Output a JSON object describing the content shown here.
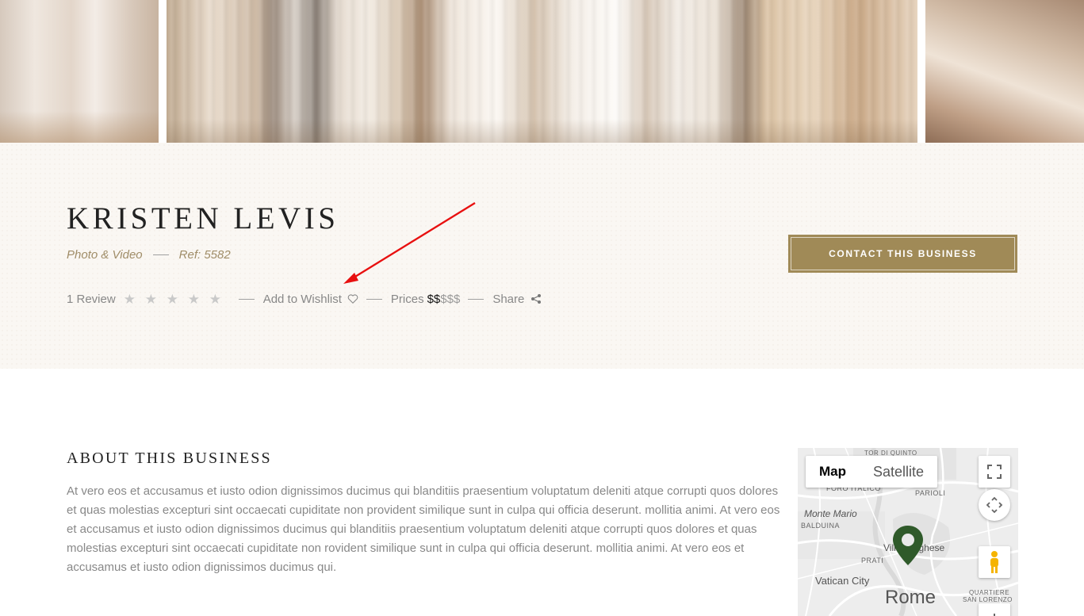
{
  "business": {
    "name": "KRISTEN LEVIS",
    "category": "Photo & Video",
    "ref": "Ref: 5582",
    "review_count": "1 Review",
    "stars_total": 5,
    "stars_filled": 0,
    "wishlist_label": "Add to Wishlist",
    "prices_label": "Prices",
    "price_active": "$$",
    "price_inactive": "$$$",
    "share_label": "Share",
    "contact_label": "CONTACT THIS BUSINESS"
  },
  "about": {
    "title": "ABOUT THIS BUSINESS",
    "text": "At vero eos et accusamus et iusto odion dignissimos ducimus qui blanditiis praesentium voluptatum deleniti atque corrupti quos dolores et quas molestias excepturi sint occaecati cupiditate non provident similique sunt in culpa qui officia deserunt. mollitia animi. At vero eos et accusamus et iusto odion dignissimos ducimus qui blanditiis praesentium voluptatum deleniti atque corrupti quos dolores et quas molestias excepturi sint occaecati cupiditate non rovident similique sunt in culpa qui officia deserunt. mollitia animi. At vero eos et accusamus et iusto odion dignissimos ducimus qui."
  },
  "map": {
    "map_label": "Map",
    "satellite_label": "Satellite",
    "places": {
      "tor_di_quinto": "TOR DI QUINTO",
      "foro_italico": "FORO ITALICO",
      "parioli": "PARIOLI",
      "monte_mario": "Monte Mario",
      "balduina": "BALDUINA",
      "villa_borghese": "Villa Borghese",
      "prati": "PRATI",
      "vatican_city": "Vatican City",
      "rome": "Rome",
      "quartiere": "QUARTIERE",
      "san_lorenzo": "SAN LORENZO"
    },
    "marker_color": "#2f5a2a"
  },
  "colors": {
    "accent": "#a08a57",
    "annotation": "#e81010"
  }
}
